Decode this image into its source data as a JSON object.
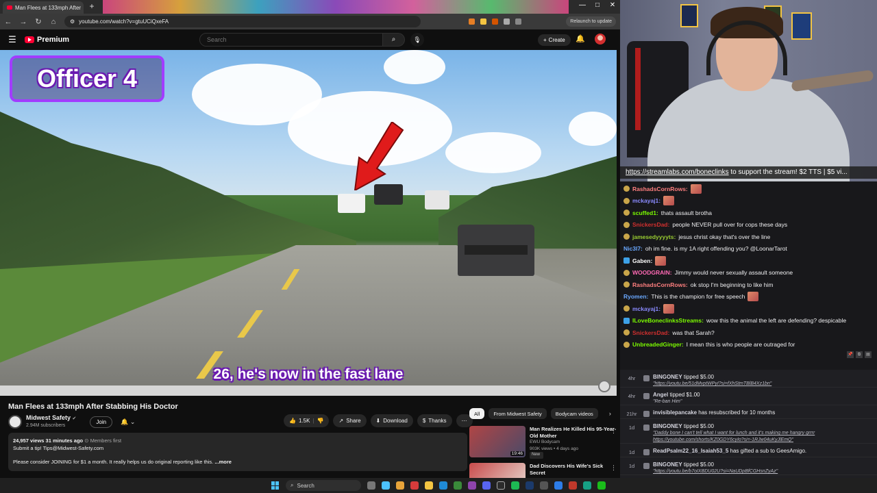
{
  "browser": {
    "tab_title": "Man Flees at 133mph After",
    "url": "youtube.com/watch?v=gtuUCiQxeFA",
    "relaunch": "Relaunch to update",
    "window_controls": [
      "—",
      "□",
      "✕"
    ]
  },
  "youtube": {
    "brand": "Premium",
    "search_placeholder": "Search",
    "create_label": "Create",
    "video": {
      "overlay_title": "Officer 4",
      "caption": "26, he's now in the fast lane",
      "title": "Man Flees at 133mph After Stabbing His Doctor"
    },
    "channel": {
      "name": "Midwest Safety",
      "subscribers": "2.94M subscribers",
      "join_label": "Join"
    },
    "actions": {
      "likes": "1.5K",
      "share": "Share",
      "download": "Download",
      "thanks": "Thanks",
      "more": "⋯"
    },
    "description": {
      "stats": "24,957 views  31 minutes ago",
      "members": "Members first",
      "line1": "Submit a tip! Tips@Midwest-Safety.com",
      "line2": "Please consider JOINING for $1 a month. It really helps us do original reporting like this.",
      "more": "...more"
    },
    "chips": [
      "All",
      "From Midwest Safety",
      "Bodycam videos"
    ],
    "recommendations": [
      {
        "title": "Man Realizes He Killed His 95-Year-Old Mother",
        "channel": "EWU Bodycam",
        "meta": "903K views • 4 days ago",
        "badge": "New",
        "duration": "19:46"
      },
      {
        "title": "Dad Discovers His Wife's Sick Secret",
        "channel": "",
        "meta": "",
        "badge": "",
        "duration": ""
      }
    ]
  },
  "stream": {
    "ticker_link": "https://streamlabs.com/boneclinks",
    "ticker_text": " to support the stream! $2 TTS | $5 vi..."
  },
  "chat": [
    {
      "user": "RashadsCornRows:",
      "color": "#ff7f7f",
      "text": "",
      "emote": true,
      "badge": "gold"
    },
    {
      "user": "mckayaj1:",
      "color": "#8a8aff",
      "text": "",
      "emote": true,
      "badge": "gold"
    },
    {
      "user": "scuffed1:",
      "color": "#7cfc00",
      "text": "thats assault brotha",
      "emote": false,
      "badge": "gold"
    },
    {
      "user": "SnickersDad:",
      "color": "#d2302f",
      "text": "people NEVER pull over for cops these days",
      "emote": false,
      "badge": "gold"
    },
    {
      "user": "jamesedyyyyts:",
      "color": "#9acd32",
      "text": "jesus christ okay that's over the line",
      "emote": false,
      "badge": "gold"
    },
    {
      "user": "Nic3l7:",
      "color": "#6aa8ff",
      "text": "oh im fine. is my 1A right offending you? @LoonarTarot",
      "emote": false,
      "badge": "none"
    },
    {
      "user": "Gaben:",
      "color": "#ffffff",
      "text": "",
      "emote": true,
      "badge": "blue"
    },
    {
      "user": "WOODGRAIN:",
      "color": "#ff69b4",
      "text": "Jimmy would never sexually assault someone",
      "emote": false,
      "badge": "gold"
    },
    {
      "user": "RashadsCornRows:",
      "color": "#ff7f7f",
      "text": "ok stop I'm beginning to like him",
      "emote": false,
      "badge": "gold"
    },
    {
      "user": "Ryomen:",
      "color": "#6aa8ff",
      "text": "This is the champion for free speech",
      "emote": true,
      "badge": "none"
    },
    {
      "user": "mckayaj1:",
      "color": "#8a8aff",
      "text": "",
      "emote": true,
      "badge": "gold"
    },
    {
      "user": "ILoveBoneclinksStreams:",
      "color": "#7cfc00",
      "text": "wow this the animal the left are defending? despicable",
      "emote": false,
      "badge": "blue"
    },
    {
      "user": "SnickersDad:",
      "color": "#d2302f",
      "text": "was that Sarah?",
      "emote": false,
      "badge": "gold"
    },
    {
      "user": "UnbreadedGinger:",
      "color": "#7cfc00",
      "text": "I mean this is who people are outraged for",
      "emote": false,
      "badge": "gold"
    }
  ],
  "events": [
    {
      "age": "4hr",
      "main_name": "BINGONEY",
      "main_rest": " tipped $5.00",
      "sub": "\"https://youtu.be/51dMvptWPyI?si=fXhStmTBlB4Xz1bn\"",
      "link": true
    },
    {
      "age": "4hr",
      "main_name": "Angel",
      "main_rest": " tipped $1.00",
      "sub": "\"Re-ban Him\"",
      "link": false
    },
    {
      "age": "21hr",
      "main_name": "invisiblepancake",
      "main_rest": " has resubscribed for 10 months",
      "sub": "",
      "link": false
    },
    {
      "age": "1d",
      "main_name": "BINGONEY",
      "main_rest": " tipped $5.00",
      "sub": "\"Daddy bone I can't tell what I want for lunch and it's making me hangry grrrr https://youtube.com/shorts/KZ0GDY6cyIo?si=-1RJw04uKyJlEmQ\"",
      "link": true
    },
    {
      "age": "1d",
      "main_name": "ReadPsalm22_16_Isaiah53_5",
      "main_rest": " has gifted a sub to GeesAmigo.",
      "sub": "",
      "link": false
    },
    {
      "age": "1d",
      "main_name": "BINGONEY",
      "main_rest": " tipped $5.00",
      "sub": "\"https://youtu.be/b7oIXBDU02U?si=NaUDpBfCGHsnZyAz\"",
      "link": true
    }
  ],
  "taskbar": {
    "search_placeholder": "Search"
  }
}
